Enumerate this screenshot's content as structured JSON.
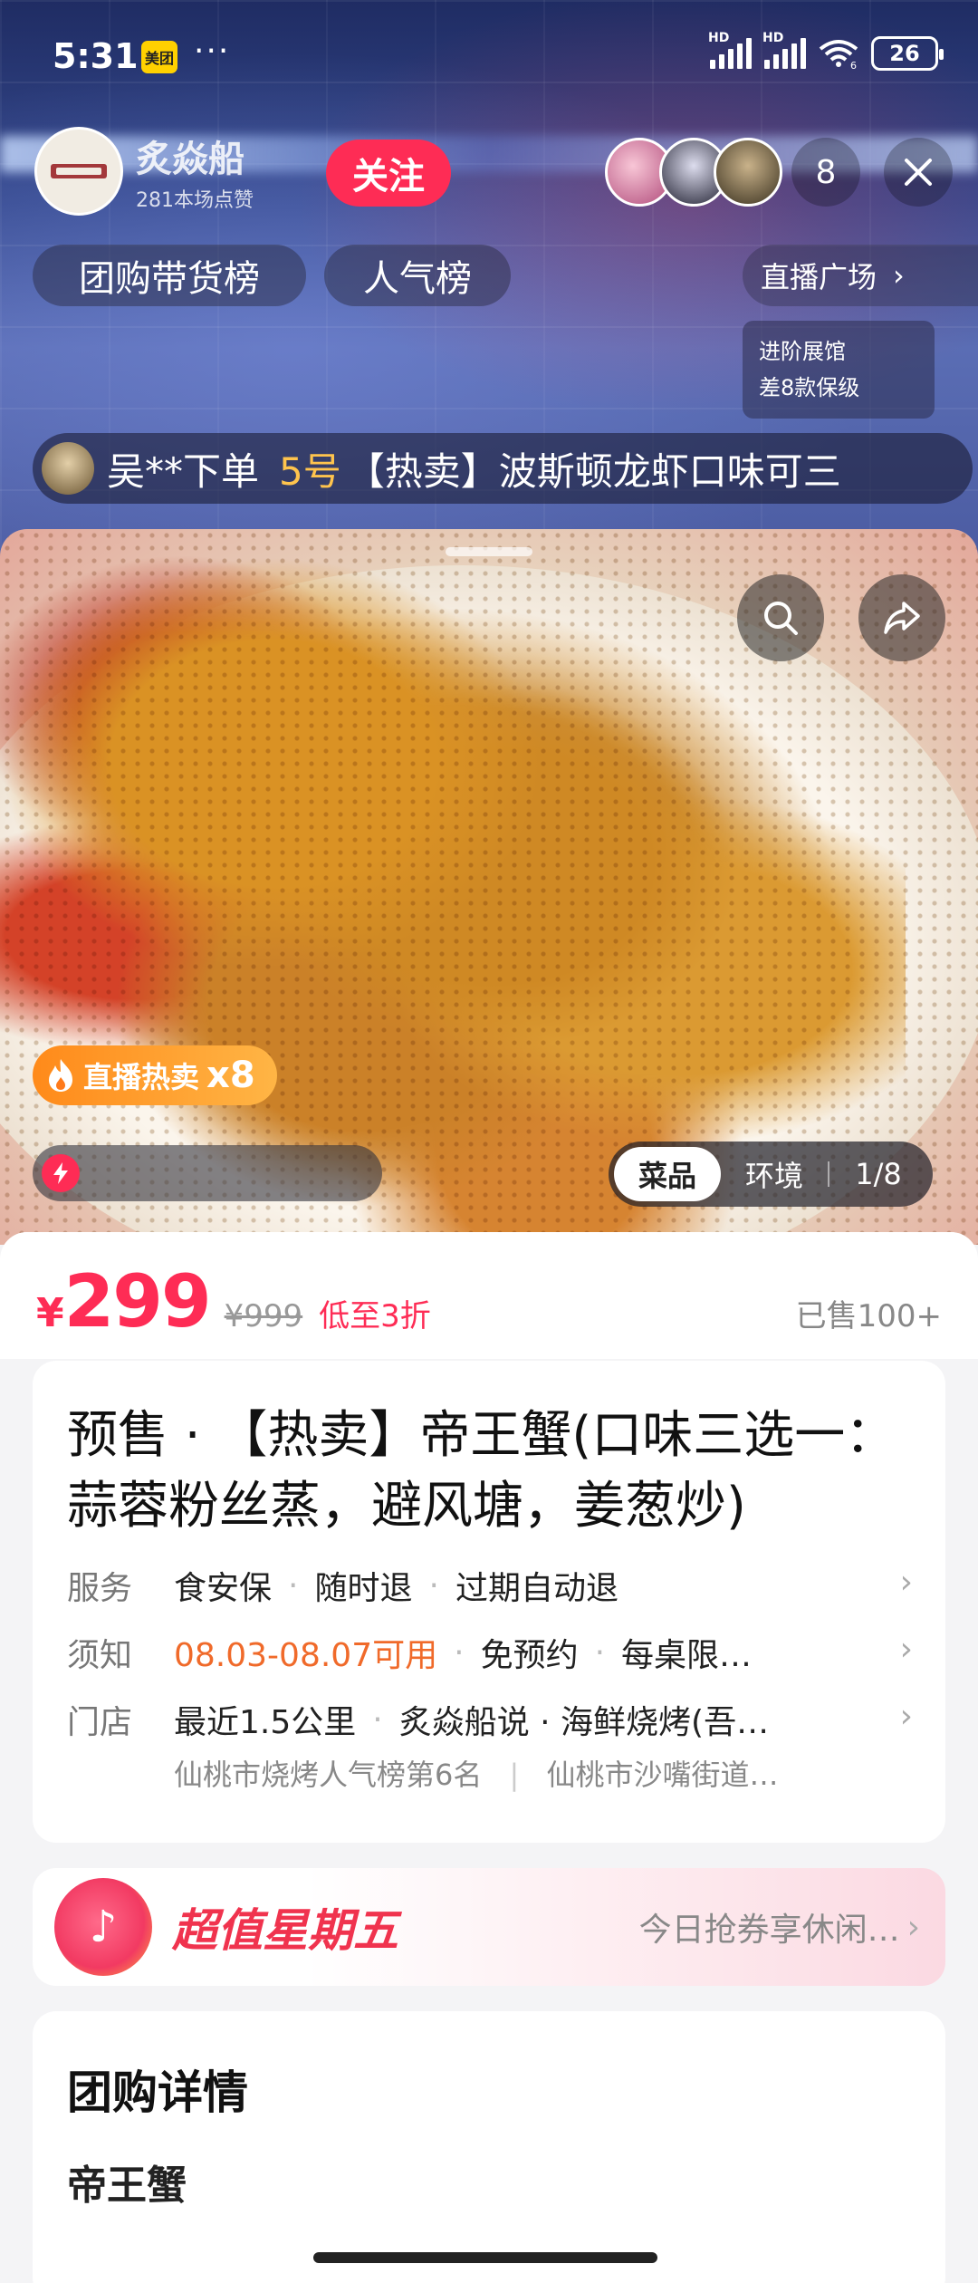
{
  "status_bar": {
    "time": "5:31",
    "app_badge": "美团",
    "more": "···",
    "network1": "HD",
    "network2": "HD",
    "wifi_badge": "6",
    "battery": "26"
  },
  "live": {
    "streamer_name": "炙焱船",
    "streamer_likes": "281本场点赞",
    "follow_label": "关注",
    "viewer_count": "8",
    "rank_tabs": [
      "团购带货榜",
      "人气榜"
    ],
    "plaza_label": "直播广场",
    "pavilion_line1": "进阶展馆",
    "pavilion_line2": "差8款保级",
    "order_ticker": {
      "buyer": "吴**下单",
      "item_no": "5号",
      "item": "【热卖】波斯顿龙虾口味可三"
    }
  },
  "photo": {
    "hot_label": "直播热卖",
    "hot_multiplier": "x8",
    "tabs": [
      "菜品",
      "环境"
    ],
    "index": "1/8",
    "progress": 0.0
  },
  "product": {
    "currency": "¥",
    "price": "299",
    "original_price": "¥999",
    "discount": "低至3折",
    "sold": "已售100+",
    "title": "预售 · 【热卖】帝王蟹(口味三选一：蒜蓉粉丝蒸，避风塘，姜葱炒)",
    "service": {
      "label": "服务",
      "items": [
        "食安保",
        "随时退",
        "过期自动退"
      ]
    },
    "notice": {
      "label": "须知",
      "date": "08.03-08.07可用",
      "items": [
        "免预约",
        "每桌限…"
      ]
    },
    "store": {
      "label": "门店",
      "distance": "最近1.5公里",
      "name": "炙焱船说 · 海鲜烧烤(吾…",
      "rank": "仙桃市烧烤人气榜第6名",
      "address": "仙桃市沙嘴街道…"
    }
  },
  "promo": {
    "logo_glyph": "♪",
    "title": "超值星期五",
    "text": "今日抢券享休闲…"
  },
  "details": {
    "title": "团购详情",
    "item": "帝王蟹"
  },
  "colors": {
    "accent": "#fe2c55",
    "orange": "#f06a2a",
    "hot_badge": "#ff9a2a"
  }
}
